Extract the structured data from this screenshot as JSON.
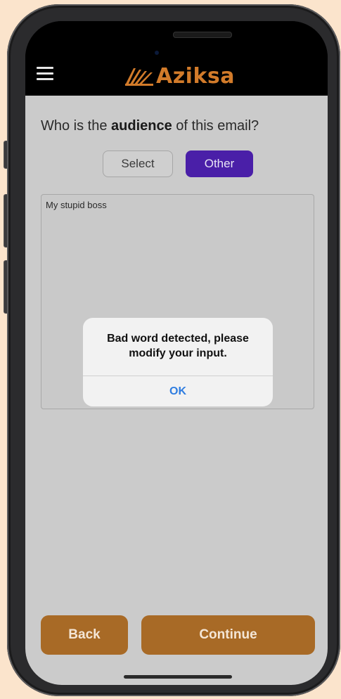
{
  "header": {
    "app_name": "Aziksa"
  },
  "question": {
    "prefix": "Who is the ",
    "emphasis": "audience",
    "suffix": " of this email?"
  },
  "segment": {
    "select_label": "Select",
    "other_label": "Other",
    "active": "Other"
  },
  "input": {
    "value": "My stupid boss"
  },
  "alert": {
    "line1": "Bad word detected, please",
    "line2": "modify your input.",
    "ok_label": "OK"
  },
  "footer": {
    "back_label": "Back",
    "continue_label": "Continue"
  },
  "colors": {
    "accent_purple": "#4a1fa8",
    "brand_orange": "#d27b2a",
    "button_brown": "#a86a26",
    "link_blue": "#2f7de0"
  },
  "icons": {
    "menu": "hamburger-menu-icon",
    "logo": "aziksa-logo-icon"
  }
}
